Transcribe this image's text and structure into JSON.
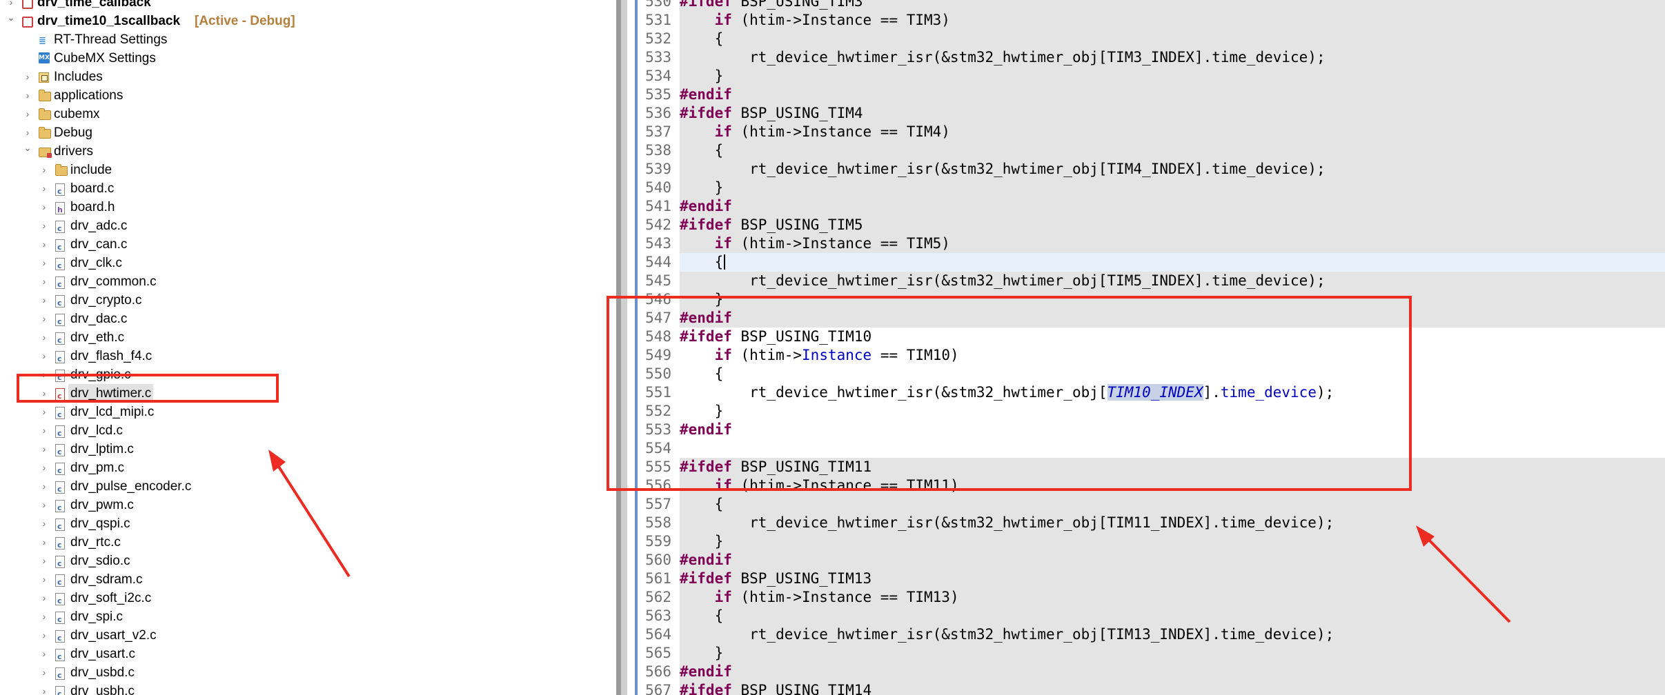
{
  "project_tree": {
    "rows": [
      {
        "label": "drv_time_callback",
        "icon": "project-icon",
        "indent": 0,
        "expanded": false,
        "bold": true
      },
      {
        "label": "drv_time10_1scallback",
        "suffix": "[Active - Debug]",
        "icon": "project-icon",
        "indent": 0,
        "expanded": true,
        "bold": true
      },
      {
        "label": "RT-Thread Settings",
        "icon": "rt-thread-icon",
        "indent": 1,
        "leaf": true
      },
      {
        "label": "CubeMX Settings",
        "icon": "cubemx-icon",
        "indent": 1,
        "leaf": true
      },
      {
        "label": "Includes",
        "icon": "includes-icon",
        "indent": 1,
        "expanded": false
      },
      {
        "label": "applications",
        "icon": "folder-icon",
        "indent": 1,
        "expanded": false
      },
      {
        "label": "cubemx",
        "icon": "folder-icon",
        "indent": 1,
        "expanded": false
      },
      {
        "label": "Debug",
        "icon": "folder-icon",
        "indent": 1,
        "expanded": false
      },
      {
        "label": "drivers",
        "icon": "source-folder-icon",
        "indent": 1,
        "expanded": true
      },
      {
        "label": "include",
        "icon": "folder-icon",
        "indent": 2,
        "expanded": false
      },
      {
        "label": "board.c",
        "icon": "c-file-icon",
        "indent": 2
      },
      {
        "label": "board.h",
        "icon": "h-file-icon",
        "indent": 2
      },
      {
        "label": "drv_adc.c",
        "icon": "c-file-icon",
        "indent": 2
      },
      {
        "label": "drv_can.c",
        "icon": "c-file-icon",
        "indent": 2
      },
      {
        "label": "drv_clk.c",
        "icon": "c-file-icon",
        "indent": 2
      },
      {
        "label": "drv_common.c",
        "icon": "c-file-icon",
        "indent": 2
      },
      {
        "label": "drv_crypto.c",
        "icon": "c-file-icon",
        "indent": 2
      },
      {
        "label": "drv_dac.c",
        "icon": "c-file-icon",
        "indent": 2
      },
      {
        "label": "drv_eth.c",
        "icon": "c-file-icon",
        "indent": 2
      },
      {
        "label": "drv_flash_f4.c",
        "icon": "c-file-icon",
        "indent": 2
      },
      {
        "label": "drv_gpio.c",
        "icon": "c-file-icon",
        "indent": 2
      },
      {
        "label": "drv_hwtimer.c",
        "icon": "c-file-error-icon",
        "indent": 2,
        "selected": true
      },
      {
        "label": "drv_lcd_mipi.c",
        "icon": "c-file-icon",
        "indent": 2
      },
      {
        "label": "drv_lcd.c",
        "icon": "c-file-icon",
        "indent": 2
      },
      {
        "label": "drv_lptim.c",
        "icon": "c-file-icon",
        "indent": 2
      },
      {
        "label": "drv_pm.c",
        "icon": "c-file-icon",
        "indent": 2
      },
      {
        "label": "drv_pulse_encoder.c",
        "icon": "c-file-icon",
        "indent": 2
      },
      {
        "label": "drv_pwm.c",
        "icon": "c-file-icon",
        "indent": 2
      },
      {
        "label": "drv_qspi.c",
        "icon": "c-file-icon",
        "indent": 2
      },
      {
        "label": "drv_rtc.c",
        "icon": "c-file-icon",
        "indent": 2
      },
      {
        "label": "drv_sdio.c",
        "icon": "c-file-icon",
        "indent": 2
      },
      {
        "label": "drv_sdram.c",
        "icon": "c-file-icon",
        "indent": 2
      },
      {
        "label": "drv_soft_i2c.c",
        "icon": "c-file-icon",
        "indent": 2
      },
      {
        "label": "drv_spi.c",
        "icon": "c-file-icon",
        "indent": 2
      },
      {
        "label": "drv_usart_v2.c",
        "icon": "c-file-icon",
        "indent": 2
      },
      {
        "label": "drv_usart.c",
        "icon": "c-file-icon",
        "indent": 2
      },
      {
        "label": "drv_usbd.c",
        "icon": "c-file-icon",
        "indent": 2
      },
      {
        "label": "drv_usbh.c",
        "icon": "c-file-icon",
        "indent": 2
      }
    ]
  },
  "editor": {
    "lines": [
      {
        "n": "530",
        "text": "#ifdef BSP_USING_TIM3",
        "bg": "gray"
      },
      {
        "n": "531",
        "text": "    if (htim->Instance == TIM3)",
        "bg": "gray"
      },
      {
        "n": "532",
        "text": "    {",
        "bg": "gray"
      },
      {
        "n": "533",
        "text": "        rt_device_hwtimer_isr(&stm32_hwtimer_obj[TIM3_INDEX].time_device);",
        "bg": "gray"
      },
      {
        "n": "534",
        "text": "    }",
        "bg": "gray"
      },
      {
        "n": "535",
        "text": "#endif",
        "bg": "gray"
      },
      {
        "n": "536",
        "text": "#ifdef BSP_USING_TIM4",
        "bg": "gray"
      },
      {
        "n": "537",
        "text": "    if (htim->Instance == TIM4)",
        "bg": "gray"
      },
      {
        "n": "538",
        "text": "    {",
        "bg": "gray"
      },
      {
        "n": "539",
        "text": "        rt_device_hwtimer_isr(&stm32_hwtimer_obj[TIM4_INDEX].time_device);",
        "bg": "gray"
      },
      {
        "n": "540",
        "text": "    }",
        "bg": "gray"
      },
      {
        "n": "541",
        "text": "#endif",
        "bg": "gray"
      },
      {
        "n": "542",
        "text": "#ifdef BSP_USING_TIM5",
        "bg": "gray"
      },
      {
        "n": "543",
        "text": "    if (htim->Instance == TIM5)",
        "bg": "gray"
      },
      {
        "n": "544",
        "text": "    {",
        "bg": "cur",
        "caret": true
      },
      {
        "n": "545",
        "text": "        rt_device_hwtimer_isr(&stm32_hwtimer_obj[TIM5_INDEX].time_device);",
        "bg": "gray"
      },
      {
        "n": "546",
        "text": "    }",
        "bg": "gray"
      },
      {
        "n": "547",
        "text": "#endif",
        "bg": "gray"
      },
      {
        "n": "548",
        "text": "#ifdef BSP_USING_TIM10",
        "bg": "white"
      },
      {
        "n": "549",
        "text": "    if (htim->Instance == TIM10)",
        "bg": "white",
        "field": "Instance"
      },
      {
        "n": "550",
        "text": "    {",
        "bg": "white"
      },
      {
        "n": "551",
        "text": "        rt_device_hwtimer_isr(&stm32_hwtimer_obj[TIM10_INDEX].time_device);",
        "bg": "white",
        "macro": "TIM10_INDEX",
        "field": "time_device"
      },
      {
        "n": "552",
        "text": "    }",
        "bg": "white"
      },
      {
        "n": "553",
        "text": "#endif",
        "bg": "white"
      },
      {
        "n": "554",
        "text": "",
        "bg": "white"
      },
      {
        "n": "555",
        "text": "#ifdef BSP_USING_TIM11",
        "bg": "gray"
      },
      {
        "n": "556",
        "text": "    if (htim->Instance == TIM11)",
        "bg": "gray"
      },
      {
        "n": "557",
        "text": "    {",
        "bg": "gray"
      },
      {
        "n": "558",
        "text": "        rt_device_hwtimer_isr(&stm32_hwtimer_obj[TIM11_INDEX].time_device);",
        "bg": "gray"
      },
      {
        "n": "559",
        "text": "    }",
        "bg": "gray"
      },
      {
        "n": "560",
        "text": "#endif",
        "bg": "gray"
      },
      {
        "n": "561",
        "text": "#ifdef BSP_USING_TIM13",
        "bg": "gray"
      },
      {
        "n": "562",
        "text": "    if (htim->Instance == TIM13)",
        "bg": "gray"
      },
      {
        "n": "563",
        "text": "    {",
        "bg": "gray"
      },
      {
        "n": "564",
        "text": "        rt_device_hwtimer_isr(&stm32_hwtimer_obj[TIM13_INDEX].time_device);",
        "bg": "gray"
      },
      {
        "n": "565",
        "text": "    }",
        "bg": "gray"
      },
      {
        "n": "566",
        "text": "#endif",
        "bg": "gray"
      },
      {
        "n": "567",
        "text": "#ifdef BSP_USING_TIM14",
        "bg": "gray"
      }
    ]
  },
  "colors": {
    "annotation_red": "#ec2b22",
    "keyword": "#7f0055",
    "field": "#0000c0",
    "line_number": "#6f6f6f",
    "active_suffix": "#b57f3d"
  }
}
